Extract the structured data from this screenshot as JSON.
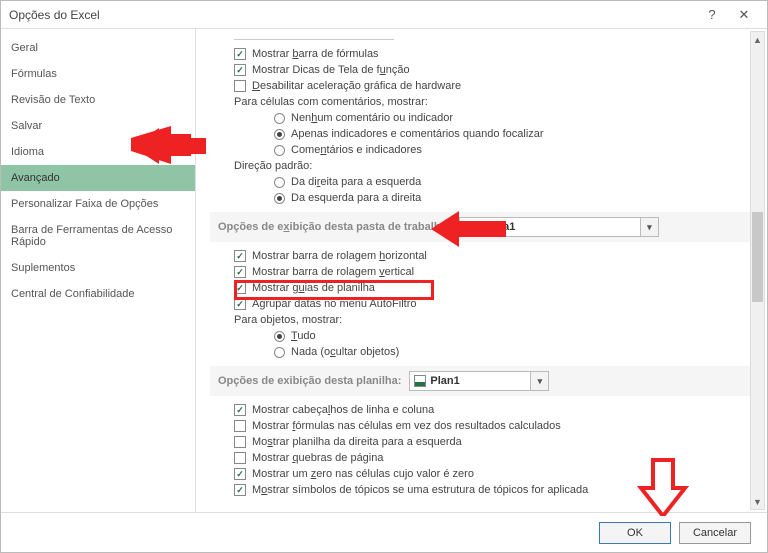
{
  "window": {
    "title": "Opções do Excel"
  },
  "sidebar": {
    "items": [
      {
        "label": "Geral"
      },
      {
        "label": "Fórmulas"
      },
      {
        "label": "Revisão de Texto"
      },
      {
        "label": "Salvar"
      },
      {
        "label": "Idioma"
      },
      {
        "label": "Avançado",
        "selected": true
      },
      {
        "label": "Personalizar Faixa de Opções"
      },
      {
        "label": "Barra de Ferramentas de Acesso Rápido"
      },
      {
        "label": "Suplementos"
      },
      {
        "label": "Central de Confiabilidade"
      }
    ]
  },
  "top_checks": {
    "formula_bar": "Mostrar barra de fórmulas",
    "screen_tips": "Mostrar Dicas de Tela de função",
    "disable_hw": "Desabilitar aceleração gráfica de hardware"
  },
  "comments": {
    "heading": "Para células com comentários, mostrar:",
    "opt1": "Nenhum comentário ou indicador",
    "opt2": "Apenas indicadores e comentários quando focalizar",
    "opt3": "Comentários e indicadores"
  },
  "direction": {
    "heading": "Direção padrão:",
    "opt1": "Da direita para a esquerda",
    "opt2": "Da esquerda para a direita"
  },
  "workbook_section": {
    "label": "Opções de exibição desta pasta de trabalho:",
    "selected": "Pasta1",
    "h_scroll": "Mostrar barra de rolagem horizontal",
    "v_scroll": "Mostrar barra de rolagem vertical",
    "tabs": "Mostrar guias de planilha",
    "autofilter": "Agrupar datas no menu AutoFiltro",
    "objects_heading": "Para objetos, mostrar:",
    "obj1": "Tudo",
    "obj2": "Nada (ocultar objetos)"
  },
  "sheet_section": {
    "label": "Opções de exibição desta planilha:",
    "selected": "Plan1",
    "headers": "Mostrar cabeçalhos de linha e coluna",
    "formulas": "Mostrar fórmulas nas células em vez dos resultados calculados",
    "rtl": "Mostrar planilha da direita para a esquerda",
    "pagebreaks": "Mostrar quebras de página",
    "zero": "Mostrar um zero nas células cujo valor é zero",
    "outline": "Mostrar símbolos de tópicos se uma estrutura de tópicos for aplicada"
  },
  "footer": {
    "ok": "OK",
    "cancel": "Cancelar"
  }
}
